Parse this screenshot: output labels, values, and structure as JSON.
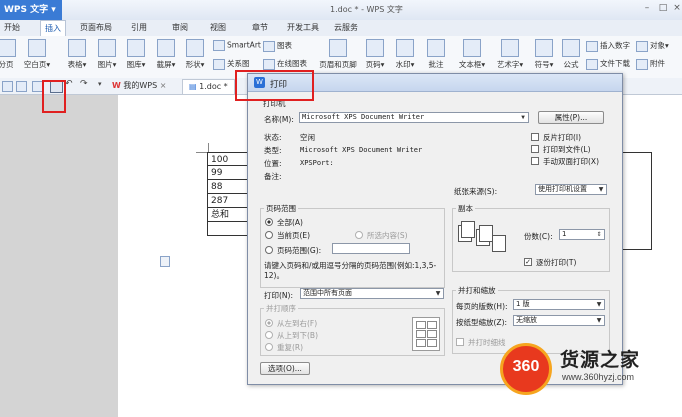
{
  "titlebar": {
    "app": "WPS 文字",
    "doc_title": "1.doc * - WPS 文字"
  },
  "menu": {
    "tabs": [
      "开始",
      "插入",
      "页面布局",
      "引用",
      "审阅",
      "视图",
      "章节",
      "开发工具",
      "云服务"
    ],
    "active": "插入"
  },
  "ribbon": {
    "left_partial": "分页",
    "items": [
      "空白页",
      "表格",
      "图片",
      "图库",
      "截屏",
      "形状",
      "页眉和页脚",
      "页码",
      "水印",
      "批注",
      "文本框",
      "艺术字",
      "符号",
      "公式"
    ],
    "small_items": {
      "smartart": "SmartArt",
      "chart": "图表",
      "online_chart": "在线图表",
      "relation": "关系图",
      "insert_number": "插入数字",
      "object": "对象",
      "file": "文件下载",
      "attachment": "附件"
    }
  },
  "tabs": {
    "home": "我的WPS",
    "doc": "1.doc *"
  },
  "table": {
    "rows": [
      "100",
      "99",
      "88",
      "287",
      "总和"
    ]
  },
  "dialog": {
    "title": "打印",
    "printer_group": "打印机",
    "name_label": "名称(M):",
    "printer_name": "Microsoft XPS Document Writer",
    "properties_btn": "属性(P)...",
    "status_label": "状态:",
    "status_value": "空闲",
    "type_label": "类型:",
    "type_value": "Microsoft XPS Document Writer",
    "location_label": "位置:",
    "location_value": "XPSPort:",
    "comment_label": "备注:",
    "reverse_print": "反片打印(I)",
    "print_to_file": "打印到文件(L)",
    "manual_duplex": "手动双面打印(X)",
    "paper_source_label": "纸张来源(S):",
    "paper_source_value": "使用打印机设置",
    "range_group": "页码范围",
    "all": "全部(A)",
    "current_page": "当前页(E)",
    "selection": "所选内容(S)",
    "page_range": "页码范围(G):",
    "range_hint": "请键入页码和/或用逗号分隔的页码范围(例如:1,3,5-12)。",
    "print_label": "打印(N):",
    "print_value": "范围中所有页面",
    "order_group": "并打顺序",
    "order_lr": "从左到右(F)",
    "order_tb": "从上到下(B)",
    "order_repeat": "重复(R)",
    "copies_group": "副本",
    "copies_label": "份数(C):",
    "copies_value": "1",
    "collate": "逐份打印(T)",
    "zoom_group": "并打和缩放",
    "pages_per_sheet_label": "每页的版数(H):",
    "pages_per_sheet_value": "1 版",
    "scale_label": "按纸型缩放(Z):",
    "scale_value": "无缩放",
    "merge_print": "并打时细线",
    "options_btn": "选项(O)..."
  },
  "watermark": {
    "logo": "360",
    "brand": "货源之家",
    "url": "www.360hyzj.com"
  },
  "colors": {
    "accent": "#3a7bd5",
    "highlight": "#e02020",
    "logo_red": "#e8391e"
  }
}
